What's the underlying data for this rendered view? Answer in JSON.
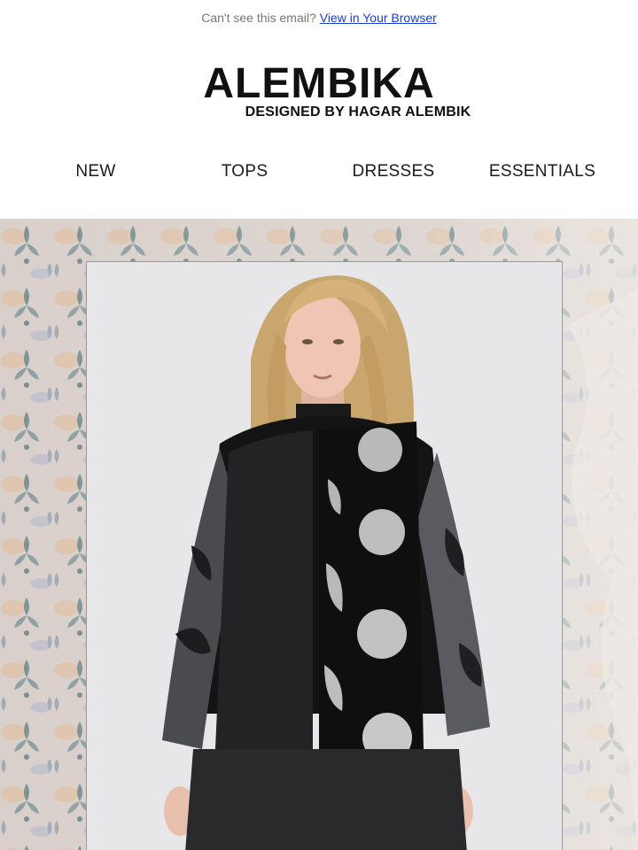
{
  "preheader": {
    "text": "Can't see this email?",
    "link_label": "View in Your Browser"
  },
  "brand": {
    "name": "ALEMBIKA",
    "tagline": "DESIGNED BY HAGAR ALEMBIK"
  },
  "nav": {
    "items": [
      {
        "label": "NEW"
      },
      {
        "label": "TOPS"
      },
      {
        "label": "DRESSES"
      },
      {
        "label": "ESSENTIALS"
      }
    ]
  },
  "hero": {
    "image": "model-wearing-black-velvet-jacket-with-silver-dots",
    "colors": {
      "backdrop": "#cfc7c3",
      "frame_bg": "#e7e7e9",
      "jacket": "#151515",
      "silver": "#b7b7b7"
    }
  }
}
